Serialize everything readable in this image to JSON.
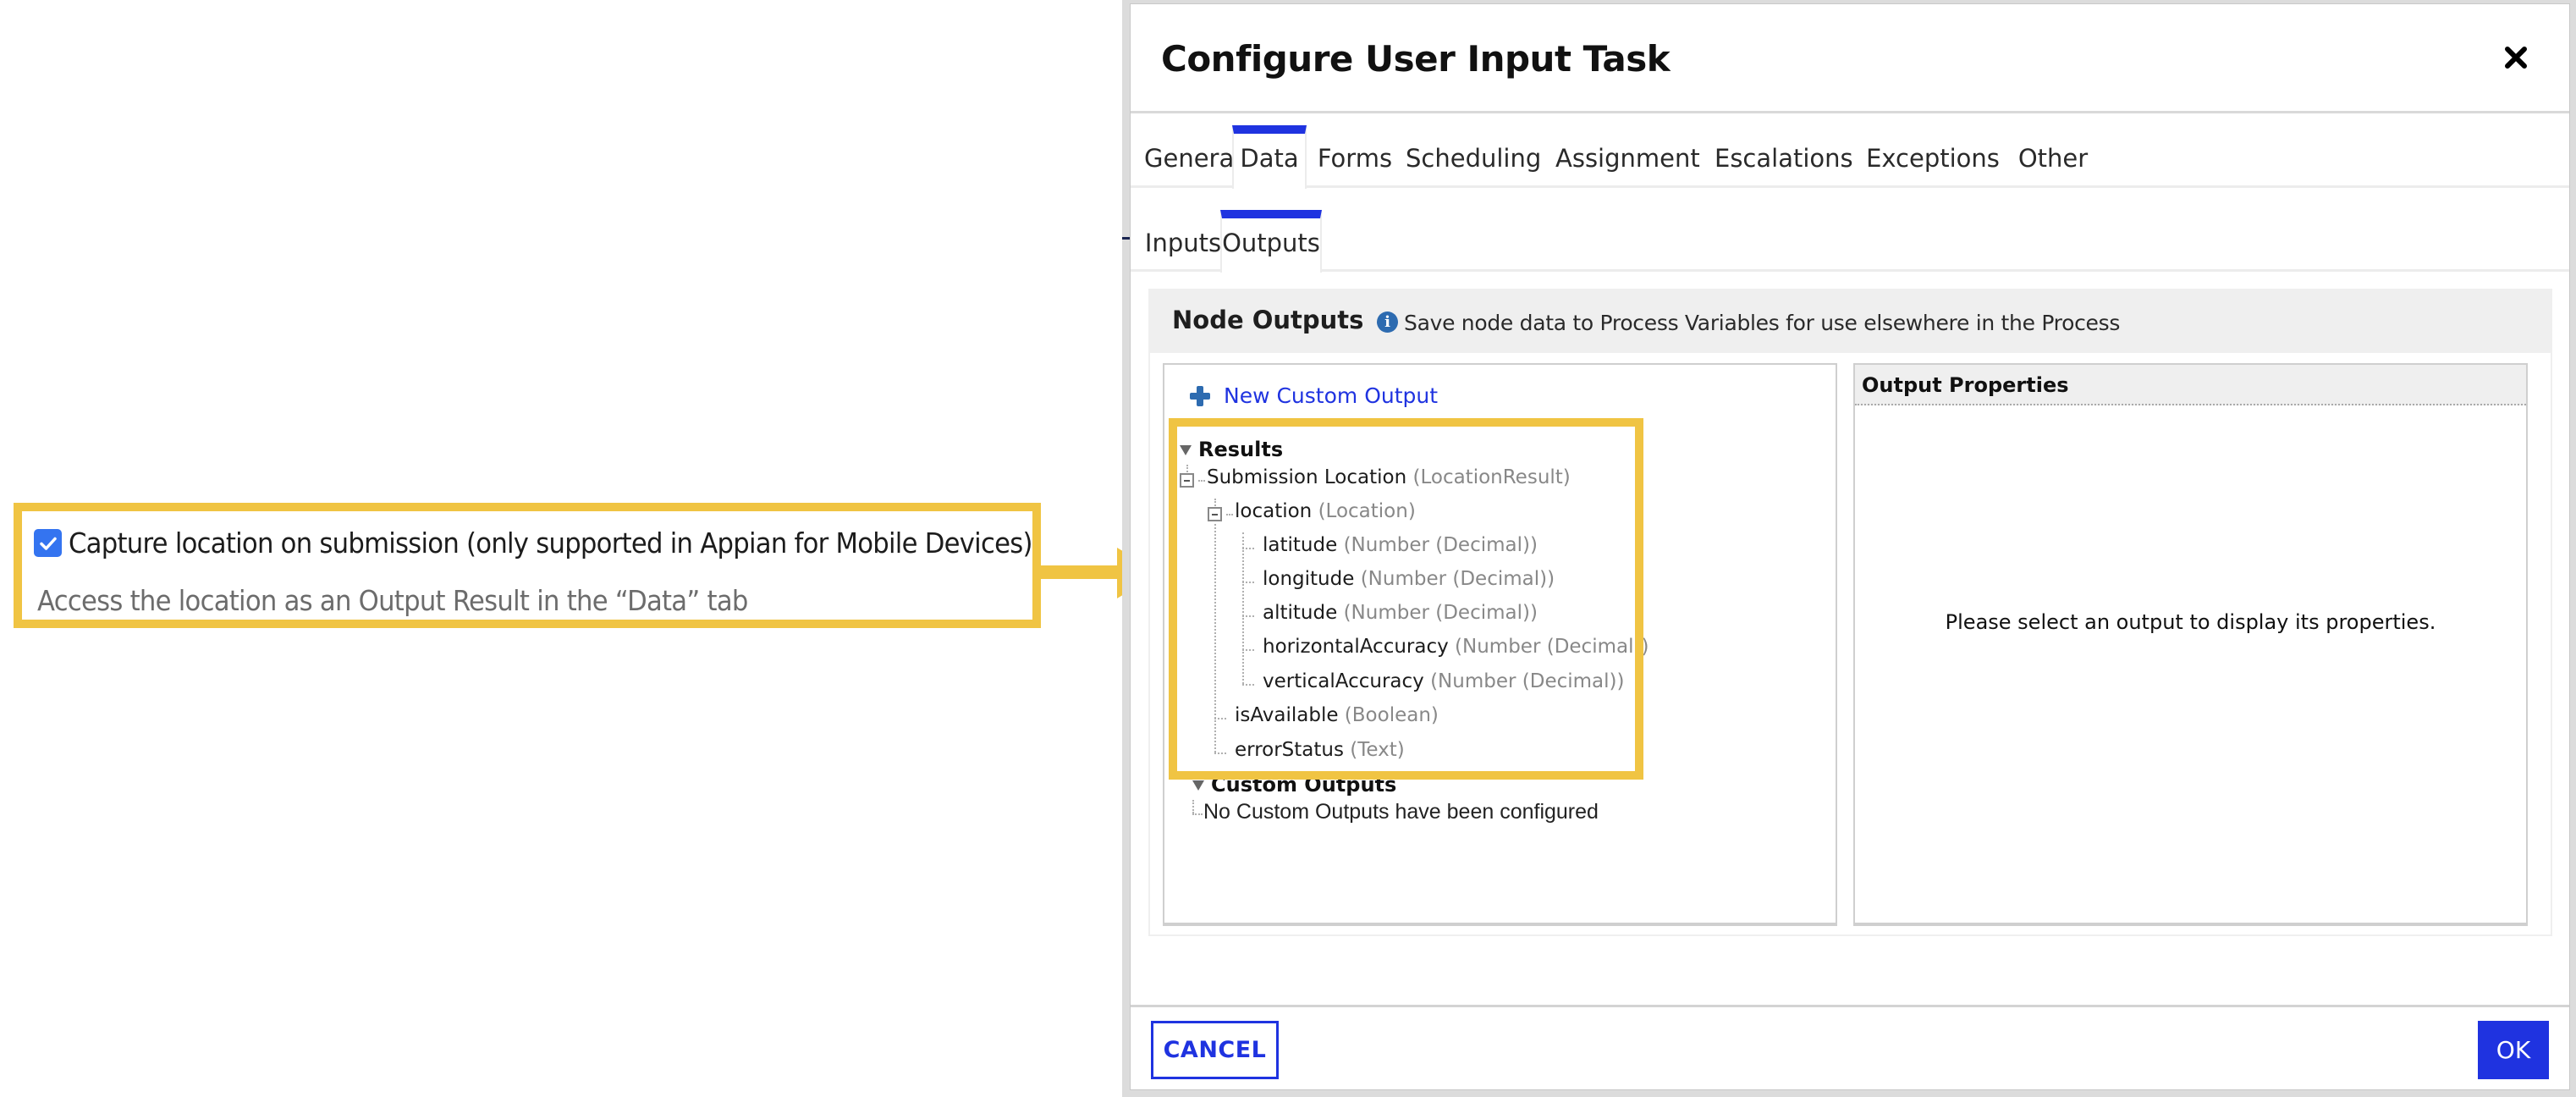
{
  "annotation": {
    "checkbox_checked": true,
    "checkbox_label": "Capture location on submission (only supported in Appian for Mobile Devices)",
    "help_text": "Access the location as an Output Result in the “Data” tab",
    "highlight_color": "#f0c443"
  },
  "dialog": {
    "title": "Configure User Input Task",
    "close_icon": "close-icon",
    "tabs": [
      {
        "label": "General",
        "active": false
      },
      {
        "label": "Data",
        "active": true
      },
      {
        "label": "Forms",
        "active": false
      },
      {
        "label": "Scheduling",
        "active": false
      },
      {
        "label": "Assignment",
        "active": false
      },
      {
        "label": "Escalations",
        "active": false
      },
      {
        "label": "Exceptions",
        "active": false
      },
      {
        "label": "Other",
        "active": false
      }
    ],
    "subtabs": [
      {
        "label": "Inputs",
        "active": false
      },
      {
        "label": "Outputs",
        "active": true
      }
    ],
    "node_outputs": {
      "title": "Node Outputs",
      "info_icon": "info-icon",
      "description": "Save node data to Process Variables for use elsewhere in the Process",
      "new_custom_output_label": "New Custom Output",
      "tree": {
        "results_label": "Results",
        "nodes": [
          {
            "name": "Submission Location",
            "type": "(LocationResult)"
          },
          {
            "name": "location",
            "type": "(Location)"
          },
          {
            "name": "latitude",
            "type": "(Number (Decimal))"
          },
          {
            "name": "longitude",
            "type": "(Number (Decimal))"
          },
          {
            "name": "altitude",
            "type": "(Number (Decimal))"
          },
          {
            "name": "horizontalAccuracy",
            "type": "(Number (Decimal))"
          },
          {
            "name": "verticalAccuracy",
            "type": "(Number (Decimal))"
          },
          {
            "name": "isAvailable",
            "type": "(Boolean)"
          },
          {
            "name": "errorStatus",
            "type": "(Text)"
          }
        ],
        "custom_outputs_label": "Custom Outputs",
        "no_custom_outputs": "No Custom Outputs have been configured"
      },
      "properties": {
        "title": "Output Properties",
        "empty_message": "Please select an output to display its properties."
      }
    },
    "footer": {
      "cancel_label": "CANCEL",
      "ok_label": "OK"
    },
    "accent_color": "#1f33e0"
  }
}
